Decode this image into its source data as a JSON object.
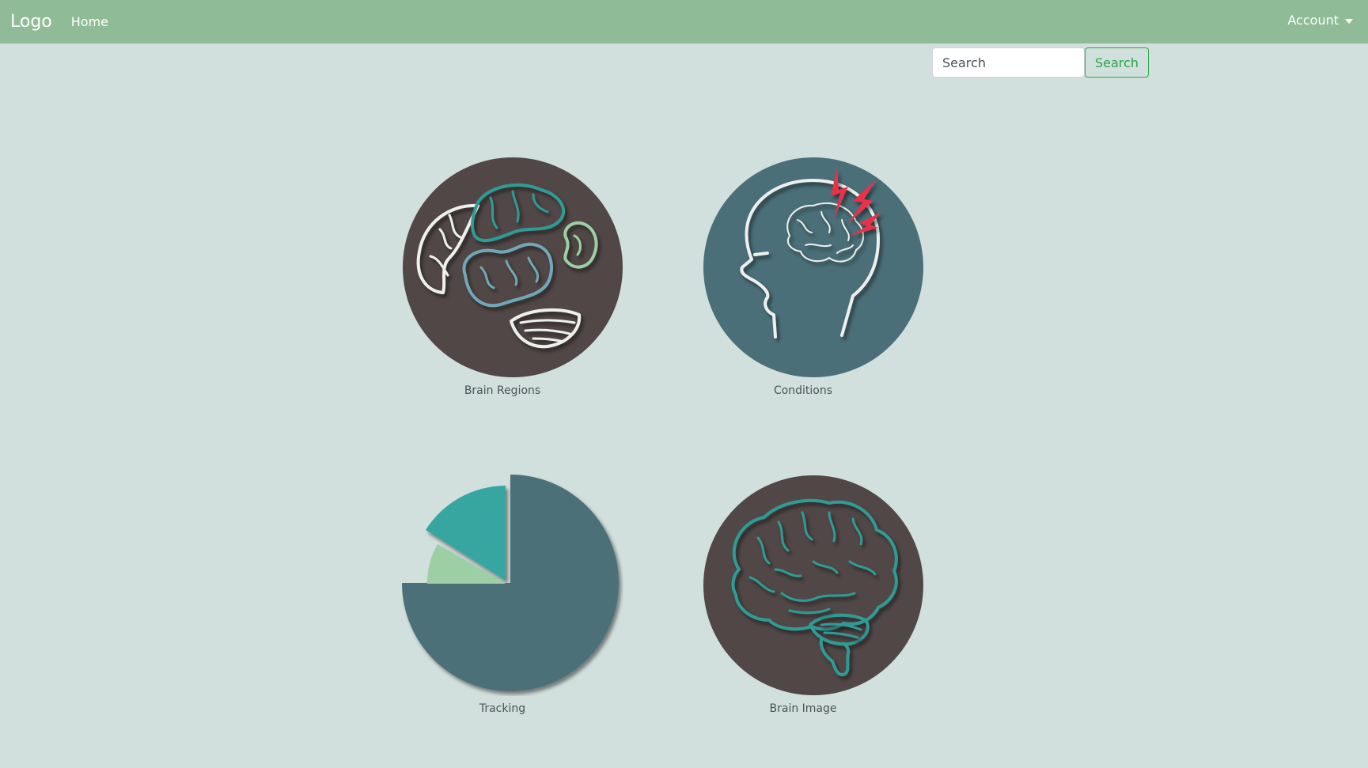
{
  "navbar": {
    "brand": "Logo",
    "home_label": "Home",
    "account_label": "Account"
  },
  "search": {
    "placeholder": "Search",
    "button_label": "Search"
  },
  "tiles": [
    {
      "label": "Brain Regions",
      "icon": "brain-regions-icon",
      "bg": "#514747"
    },
    {
      "label": "Conditions",
      "icon": "head-lightning-icon",
      "bg": "#4b6f78"
    },
    {
      "label": "Tracking",
      "icon": "pie-chart-icon",
      "bg": "#4b6f78"
    },
    {
      "label": "Brain Image",
      "icon": "brain-icon",
      "bg": "#514747"
    }
  ],
  "colors": {
    "navbar": "#8fbc97",
    "background": "#d2e0dd",
    "teal": "#39a6a0",
    "light_green": "#9ccfa3",
    "slate": "#4b6f78",
    "dark_brown": "#514747",
    "alert_red": "#e8334a",
    "search_green": "#28a745"
  }
}
